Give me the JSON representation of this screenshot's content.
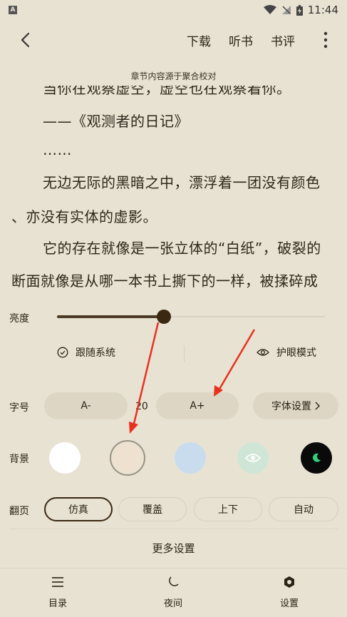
{
  "status_bar": {
    "time": "11:44",
    "app_badge": "A"
  },
  "top_bar": {
    "download": "下载",
    "listen": "听书",
    "review": "书评"
  },
  "source_note": "章节内容源于聚合校对",
  "reader": {
    "lines": [
      "当你在观察虚空，虚空也在观察着你。",
      "——《观测者的日记》",
      "……",
      "无边无际的黑暗之中，漂浮着一团没有颜色",
      "、亦没有实体的虚影。",
      "它的存在就像是一张立体的“白纸”，破裂的",
      "断面就像是从哪一本书上撕下的一样，被揉碎成"
    ]
  },
  "settings": {
    "brightness": {
      "label": "亮度",
      "level": 0.4
    },
    "follow_system": "跟随系统",
    "eye_care": "护眼模式",
    "font_size": {
      "label": "字号",
      "decrease": "A-",
      "value": "20",
      "increase": "A+",
      "font_settings": "字体设置"
    },
    "background": {
      "label": "背景",
      "swatches": [
        {
          "name": "white",
          "color": "#ffffff"
        },
        {
          "name": "beige",
          "color": "#eee1cf",
          "selected": true
        },
        {
          "name": "blue",
          "color": "#c9dcee"
        },
        {
          "name": "green",
          "color": "#cfe6d6"
        },
        {
          "name": "night",
          "color": "#0a0a0a"
        }
      ]
    },
    "page_turn": {
      "label": "翻页",
      "options": [
        "仿真",
        "覆盖",
        "上下",
        "自动"
      ],
      "selected": "仿真"
    },
    "more": "更多设置"
  },
  "bottom_nav": {
    "toc": "目录",
    "night": "夜间",
    "settings": "设置"
  },
  "colors": {
    "accent": "#3a2812",
    "background": "#e8e2d2",
    "annotation_arrow": "#e8311f"
  }
}
